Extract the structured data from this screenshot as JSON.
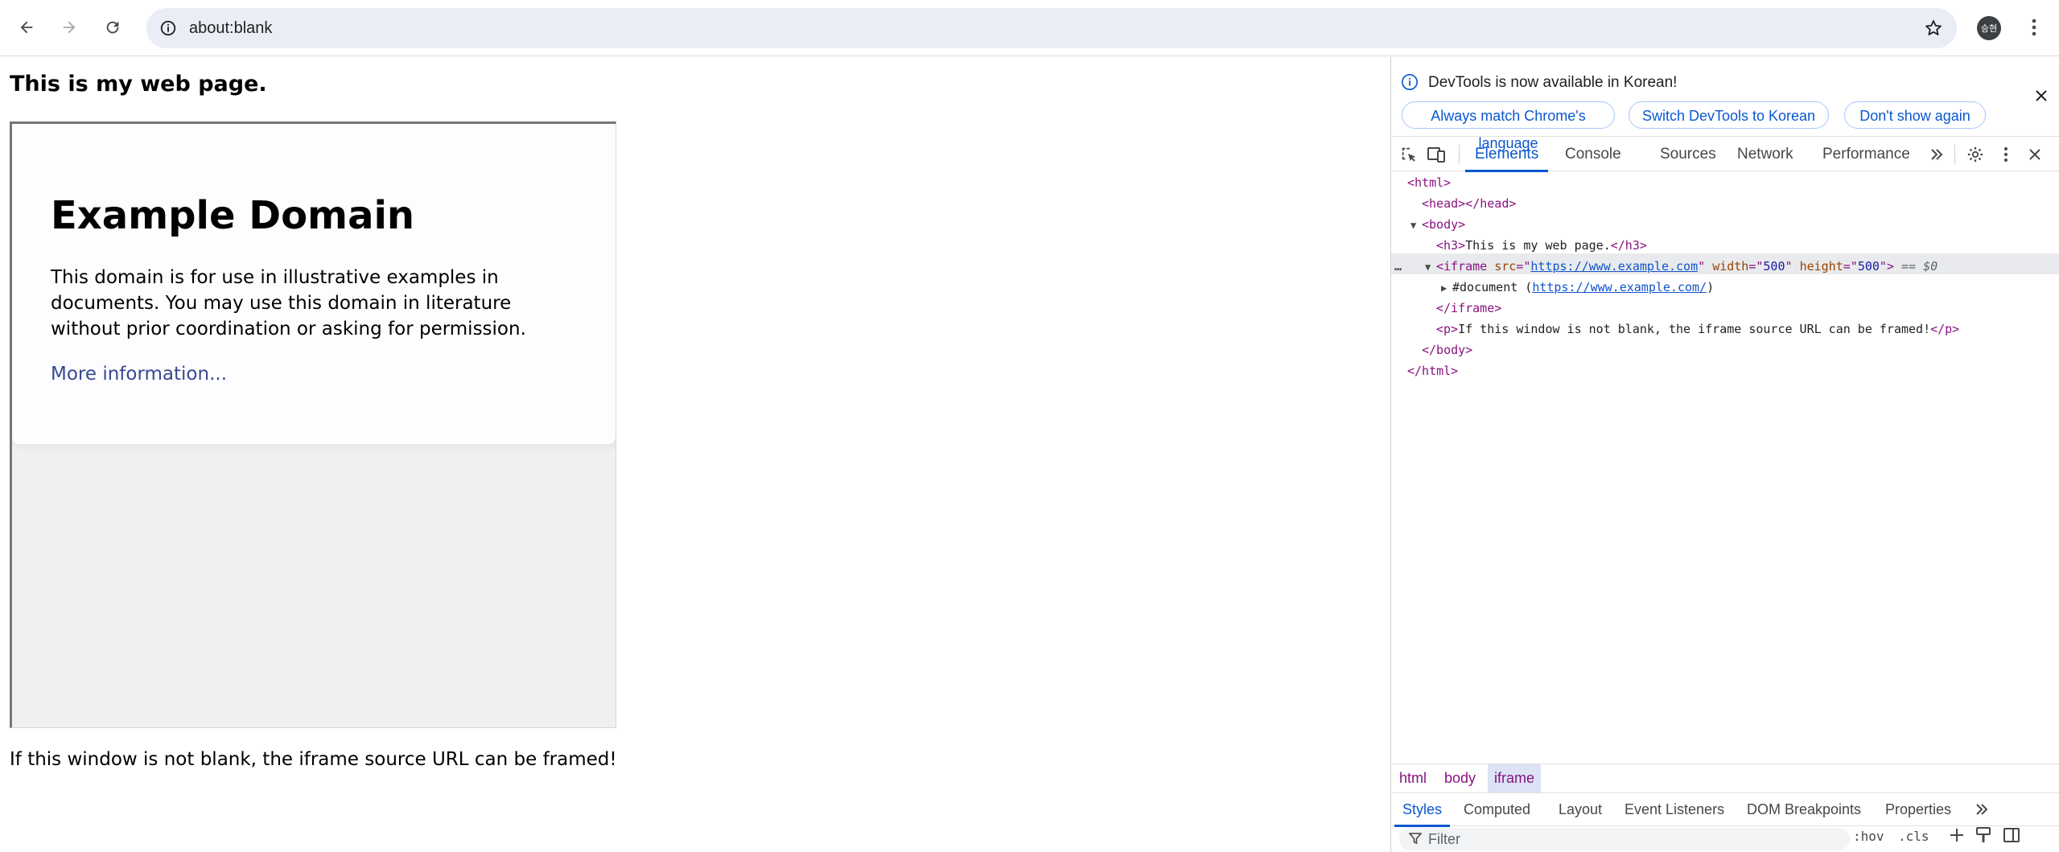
{
  "browser": {
    "url": "about:blank",
    "avatar_text": "승현",
    "icons": [
      "back-icon",
      "forward-icon",
      "reload-icon",
      "info-icon",
      "star-icon",
      "menu-icon"
    ]
  },
  "page": {
    "heading": "This is my web page.",
    "iframe": {
      "title": "Example Domain",
      "description": "This domain is for use in illustrative examples in documents. You may use this domain in literature without prior coordination or asking for permission.",
      "link_text": "More information..."
    },
    "note": "If this window is not blank, the iframe source URL can be framed!"
  },
  "devtools": {
    "infobar": {
      "message": "DevTools is now available in Korean!",
      "buttons": [
        "Always match Chrome's language",
        "Switch DevTools to Korean",
        "Don't show again"
      ]
    },
    "tabs": [
      "Elements",
      "Console",
      "Sources",
      "Network",
      "Performance"
    ],
    "active_tab": "Elements",
    "dom": {
      "html_open": "<html>",
      "head": "<head></head>",
      "body_open": "<body>",
      "h3_open": "<h3>",
      "h3_text": "This is my web page.",
      "h3_close": "</h3>",
      "iframe_tag": "<iframe",
      "src_attr": "src",
      "src_val": "https://www.example.com",
      "width_attr": "width",
      "width_val": "500",
      "height_attr": "height",
      "height_val": "500",
      "iframe_end": ">",
      "selected_marker": "== $0",
      "document_label": "#document (",
      "document_url": "https://www.example.com/",
      "document_close": ")",
      "iframe_close": "</iframe>",
      "p_open": "<p>",
      "p_text": "If this window is not blank, the iframe source URL can be framed!",
      "p_close": "</p>",
      "body_close": "</body>",
      "html_close": "</html>",
      "ellipsis": "…"
    },
    "breadcrumbs": [
      "html",
      "body",
      "iframe"
    ],
    "styles_tabs": [
      "Styles",
      "Computed",
      "Layout",
      "Event Listeners",
      "DOM Breakpoints",
      "Properties"
    ],
    "filter_placeholder": "Filter",
    "filter_tools": [
      ":hov",
      ".cls"
    ]
  }
}
